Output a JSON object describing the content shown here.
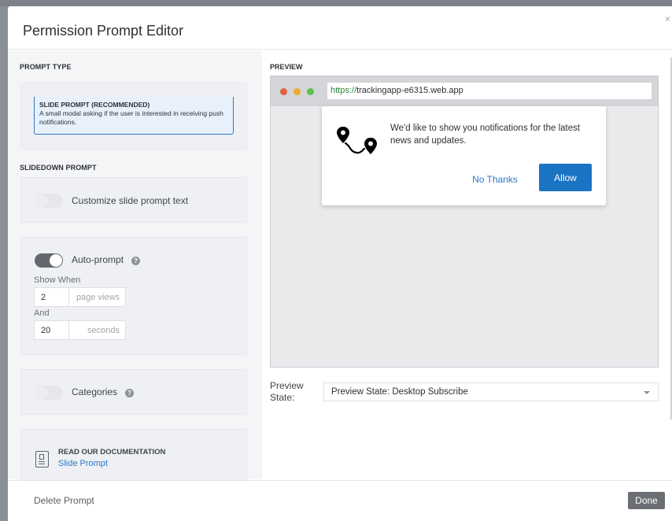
{
  "header": {
    "title": "Permission Prompt Editor",
    "close_glyph": "×"
  },
  "left": {
    "prompt_type_label": "PROMPT TYPE",
    "prompt_option": {
      "title": "SLIDE PROMPT (RECOMMENDED)",
      "description": "A small modal asking if the user is interested in receiving push notifications."
    },
    "slidedown_label": "SLIDEDOWN PROMPT",
    "customize": {
      "label": "Customize slide prompt text",
      "enabled": false
    },
    "auto_prompt": {
      "label": "Auto-prompt",
      "enabled": true,
      "show_when_label": "Show When",
      "page_views_value": "2",
      "page_views_unit": "page views",
      "and_label": "And",
      "seconds_value": "20",
      "seconds_unit": "seconds"
    },
    "categories": {
      "label": "Categories",
      "enabled": false
    },
    "documentation": {
      "title": "READ OUR DOCUMENTATION",
      "link": "Slide Prompt"
    },
    "help_glyph": "?"
  },
  "preview": {
    "label": "PREVIEW",
    "url_protocol": "https://",
    "url_host": "trackingapp-e6315.web.app",
    "traffic_colors": [
      "#e0623e",
      "#f0a930",
      "#5fbf4e"
    ],
    "notification": {
      "message": "We'd like to show you notifications for the latest news and updates.",
      "no_thanks_label": "No Thanks",
      "allow_label": "Allow"
    },
    "state_label": "Preview State:",
    "state_value": "Preview State: Desktop Subscribe"
  },
  "footer": {
    "delete_label": "Delete Prompt",
    "done_label": "Done"
  },
  "colors": {
    "accent": "#1b73c3",
    "link": "#2e78c7",
    "done_button": "#6b6f74"
  }
}
